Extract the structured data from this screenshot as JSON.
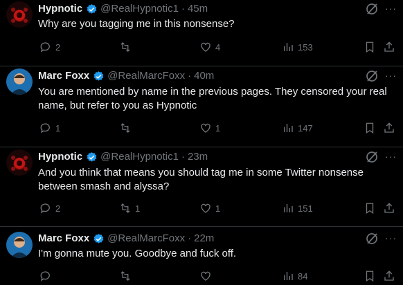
{
  "tweets": [
    {
      "name": "Hypnotic",
      "handle": "@RealHypnotic1",
      "time": "45m",
      "text": "Why are you tagging me in this nonsense?",
      "avatar": "hypnotic-avatar",
      "replies": "2",
      "retweets": "",
      "likes": "4",
      "views": "153"
    },
    {
      "name": "Marc Foxx",
      "handle": "@RealMarcFoxx",
      "time": "40m",
      "text": "You are mentioned by name in the previous pages. They censored your real name, but refer to you as Hypnotic",
      "avatar": "marc-foxx-avatar",
      "replies": "1",
      "retweets": "",
      "likes": "1",
      "views": "147"
    },
    {
      "name": "Hypnotic",
      "handle": "@RealHypnotic1",
      "time": "23m",
      "text": "And you think that means you should tag me in some Twitter nonsense between smash and alyssa?",
      "avatar": "hypnotic-avatar",
      "replies": "2",
      "retweets": "1",
      "likes": "1",
      "views": "151"
    },
    {
      "name": "Marc Foxx",
      "handle": "@RealMarcFoxx",
      "time": "22m",
      "text": "I'm gonna mute you. Goodbye and fuck off.",
      "avatar": "marc-foxx-avatar",
      "replies": "",
      "retweets": "",
      "likes": "",
      "views": "84"
    }
  ],
  "separator": "·",
  "colors": {
    "background": "#000000",
    "text": "#e7e9ea",
    "muted": "#71767b",
    "verified": "#1d9bf0",
    "divider": "#2f3336"
  }
}
